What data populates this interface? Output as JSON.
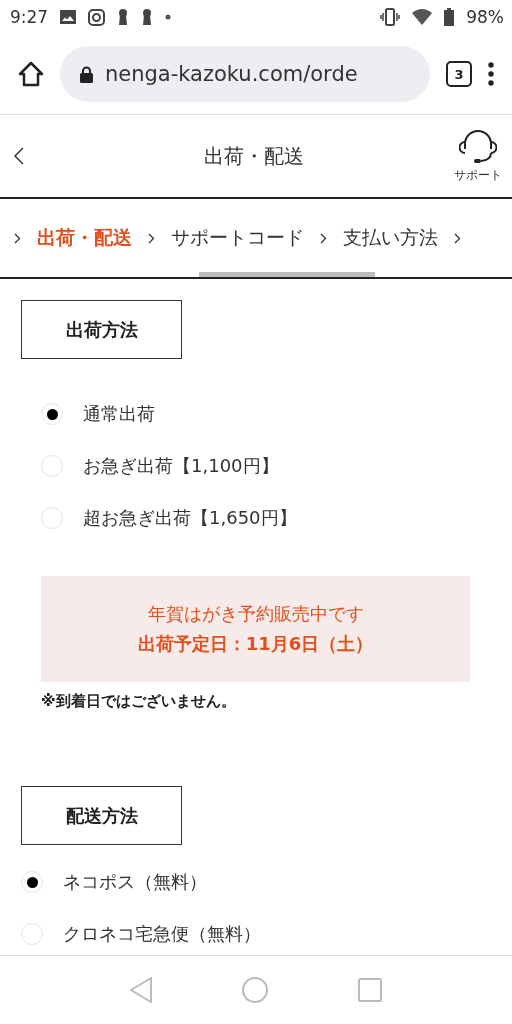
{
  "status_bar": {
    "time": "9:27",
    "battery": "98%"
  },
  "browser": {
    "url": "nenga-kazoku.com/orde",
    "tab_count": "3"
  },
  "header": {
    "title": "出荷・配送",
    "support_label": "サポート"
  },
  "steps": [
    {
      "label": "出荷・配送",
      "selected": true
    },
    {
      "label": "サポートコード",
      "selected": false
    },
    {
      "label": "支払い方法",
      "selected": false
    }
  ],
  "shipping": {
    "heading": "出荷方法",
    "options": [
      {
        "label": "通常出荷",
        "selected": true
      },
      {
        "label": "お急ぎ出荷【1,100円】",
        "selected": false
      },
      {
        "label": "超お急ぎ出荷【1,650円】",
        "selected": false
      }
    ],
    "notice": {
      "line1": "年賀はがき予約販売中です",
      "line2": "出荷予定日：11月6日（土）"
    },
    "note": "※到着日ではございません。"
  },
  "delivery": {
    "heading": "配送方法",
    "options": [
      {
        "label": "ネコポス（無料）",
        "selected": true
      },
      {
        "label": "クロネコ宅急便（無料）",
        "selected": false
      }
    ]
  }
}
